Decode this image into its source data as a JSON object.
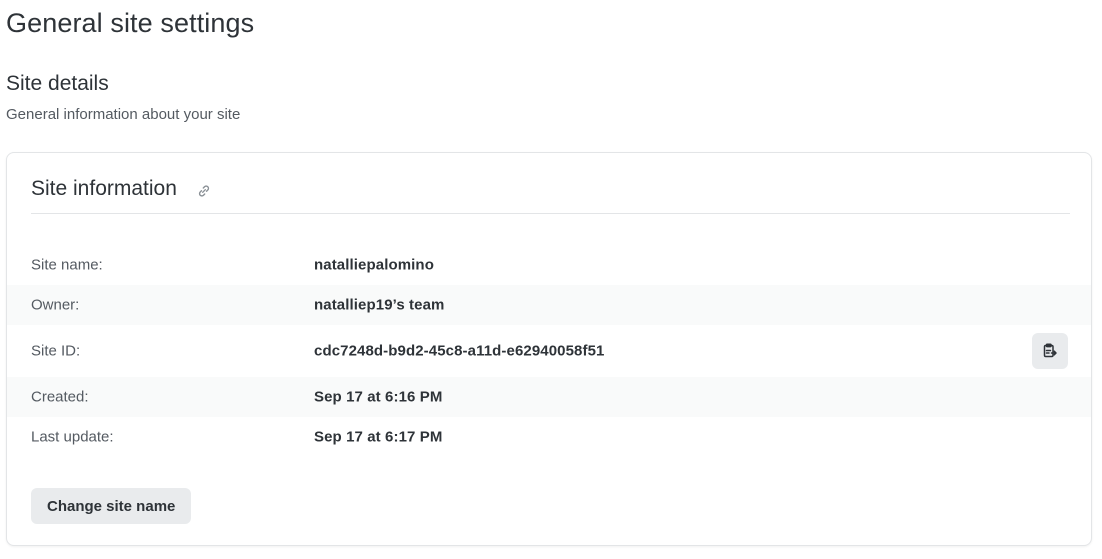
{
  "page": {
    "title": "General site settings"
  },
  "section": {
    "title": "Site details",
    "subtitle": "General information about your site"
  },
  "card": {
    "title": "Site information",
    "link_icon": "link-icon",
    "rows": [
      {
        "label": "Site name:",
        "value": "natalliepalomino"
      },
      {
        "label": "Owner:",
        "value": "natalliep19’s team"
      },
      {
        "label": "Site ID:",
        "value": "cdc7248d-b9d2-45c8-a11d-e62940058f51",
        "action_icon": "clipboard-copy-icon"
      },
      {
        "label": "Created:",
        "value": "Sep 17 at 6:16 PM"
      },
      {
        "label": "Last update:",
        "value": "Sep 17 at 6:17 PM"
      }
    ],
    "change_button_label": "Change site name"
  },
  "colors": {
    "text_primary": "#2e3338",
    "text_secondary": "#545a61",
    "row_shade": "#f9fafa",
    "button_bg": "#e9ebed",
    "border": "#e3e5e7"
  }
}
